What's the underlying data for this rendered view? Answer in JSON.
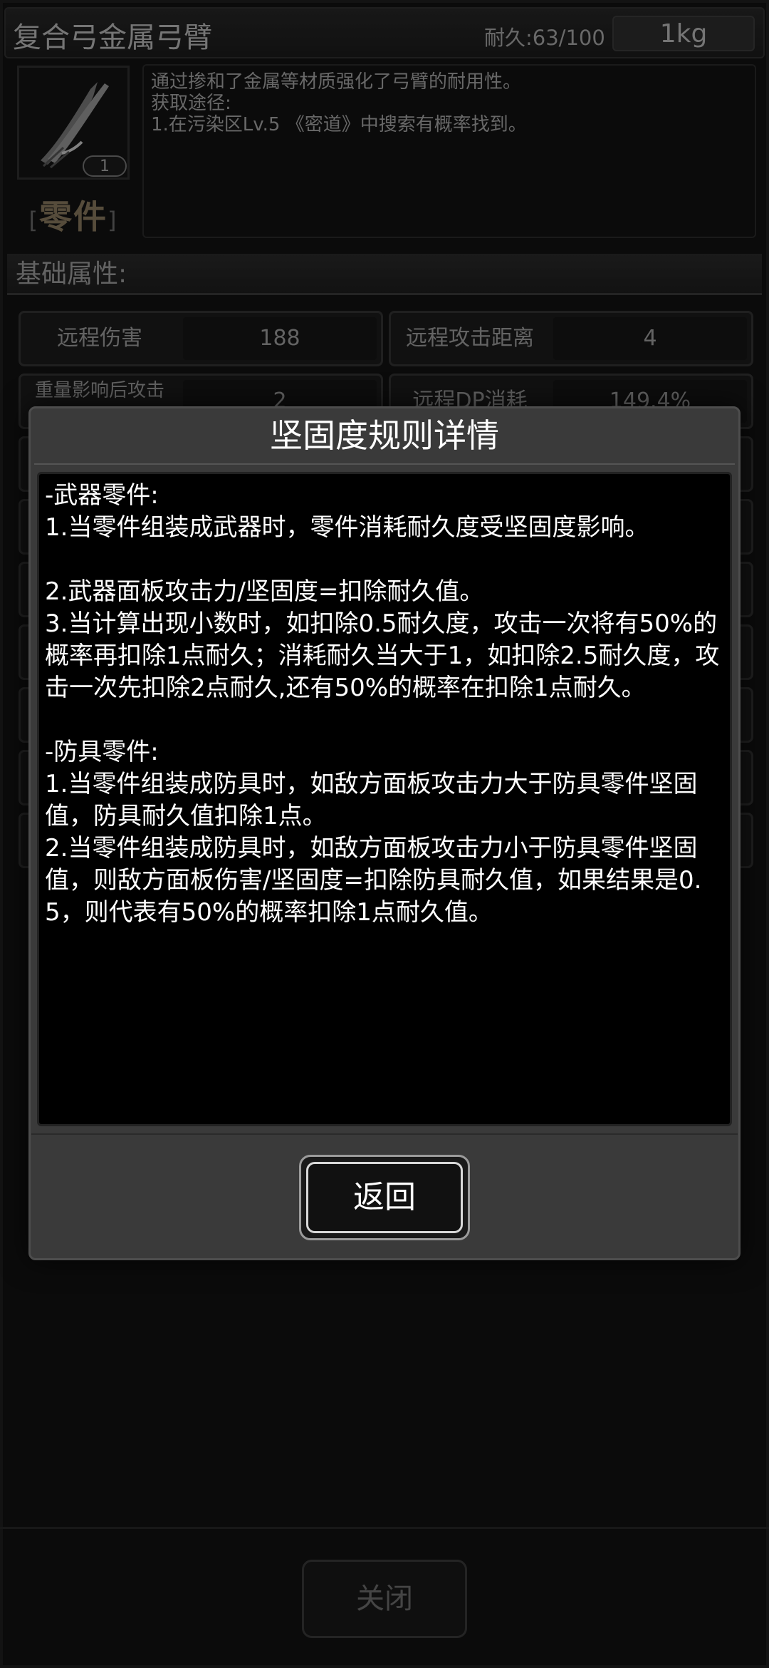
{
  "item": {
    "title": "复合弓金属弓臂",
    "durability": "耐久:63/100",
    "weight": "1kg",
    "count": "1",
    "type_label": "零件",
    "type_bracket_left": "[",
    "type_bracket_right": "]",
    "description": "通过掺和了金属等材质强化了弓臂的耐用性。\n获取途径:\n1.在污染区Lv.5 《密道》中搜索有概率找到。"
  },
  "section": {
    "basic_attributes": "基础属性:"
  },
  "stats": [
    {
      "label": "远程伤害",
      "value": "188"
    },
    {
      "label": "远程攻击距离",
      "value": "4"
    },
    {
      "label": "重量影响后攻击",
      "value": "2"
    },
    {
      "label": "远程DP消耗",
      "value": "149.4%"
    }
  ],
  "modal": {
    "title": "坚固度规则详情",
    "rules_text": "-武器零件:\n1.当零件组装成武器时，零件消耗耐久度受坚固度影响。\n\n2.武器面板攻击力/坚固度=扣除耐久值。\n3.当计算出现小数时，如扣除0.5耐久度，攻击一次将有50%的概率再扣除1点耐久；消耗耐久当大于1，如扣除2.5耐久度，攻击一次先扣除2点耐久,还有50%的概率在扣除1点耐久。\n\n-防具零件:\n1.当零件组装成防具时，如敌方面板攻击力大于防具零件坚固值，防具耐久值扣除1点。\n2.当零件组装成防具时，如敌方面板攻击力小于防具零件坚固值，则敌方面板伤害/坚固度=扣除防具耐久值，如果结果是0.5，则代表有50%的概率扣除1点耐久值。",
    "back_button": "返回"
  },
  "footer": {
    "close_button": "关闭"
  },
  "colors": {
    "type_label": "#8b7b5f",
    "modal_bg": "#3a3a3a"
  },
  "icons": {
    "item_icon": "bow-limb-icon"
  }
}
